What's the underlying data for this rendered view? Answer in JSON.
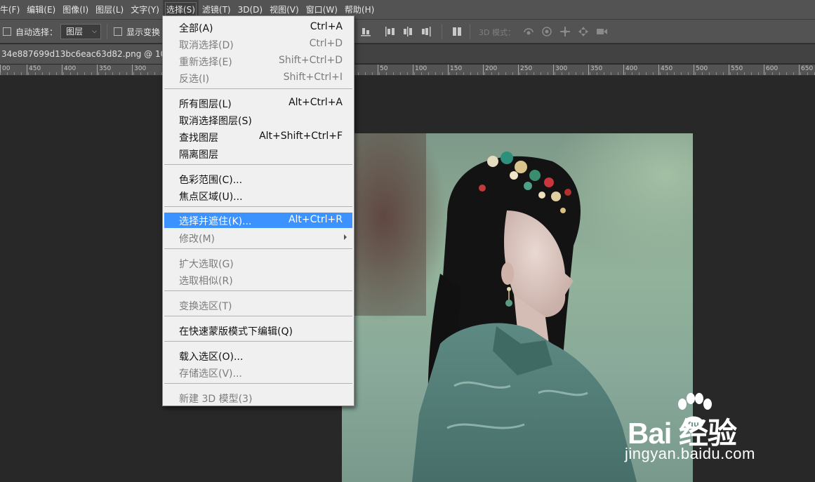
{
  "menubar": {
    "items": [
      "牛(F)",
      "编辑(E)",
      "图像(I)",
      "图层(L)",
      "文字(Y)",
      "选择(S)",
      "滤镜(T)",
      "3D(D)",
      "视图(V)",
      "窗口(W)",
      "帮助(H)"
    ],
    "active": "选择(S)"
  },
  "options": {
    "auto_select_label": "自动选择：",
    "layer_dropdown": "图层",
    "show_transform_label": "显示变换",
    "mode_3d_label": "3D 模式："
  },
  "document": {
    "tab_title": "34e887699d13bc6eac63d82.png @ 100%(..."
  },
  "ruler": {
    "labels": [
      "00",
      "450",
      "400",
      "350",
      "300",
      "50",
      "100",
      "150",
      "200",
      "250",
      "300",
      "350",
      "400",
      "450",
      "500",
      "550",
      "600",
      "650"
    ]
  },
  "select_menu": {
    "items": [
      {
        "label": "全部(A)",
        "shortcut": "Ctrl+A",
        "enabled": true
      },
      {
        "label": "取消选择(D)",
        "shortcut": "Ctrl+D",
        "enabled": false
      },
      {
        "label": "重新选择(E)",
        "shortcut": "Shift+Ctrl+D",
        "enabled": false
      },
      {
        "label": "反选(I)",
        "shortcut": "Shift+Ctrl+I",
        "enabled": false
      },
      {
        "label": "所有图层(L)",
        "shortcut": "Alt+Ctrl+A",
        "enabled": true
      },
      {
        "label": "取消选择图层(S)",
        "shortcut": "",
        "enabled": true
      },
      {
        "label": "查找图层",
        "shortcut": "Alt+Shift+Ctrl+F",
        "enabled": true
      },
      {
        "label": "隔离图层",
        "shortcut": "",
        "enabled": true
      },
      {
        "label": "色彩范围(C)...",
        "shortcut": "",
        "enabled": true
      },
      {
        "label": "焦点区域(U)...",
        "shortcut": "",
        "enabled": true
      },
      {
        "label": "选择并遮住(K)...",
        "shortcut": "Alt+Ctrl+R",
        "enabled": true,
        "highlighted": true
      },
      {
        "label": "修改(M)",
        "shortcut": "",
        "enabled": false,
        "submenu": true
      },
      {
        "label": "扩大选取(G)",
        "shortcut": "",
        "enabled": false
      },
      {
        "label": "选取相似(R)",
        "shortcut": "",
        "enabled": false
      },
      {
        "label": "变换选区(T)",
        "shortcut": "",
        "enabled": false
      },
      {
        "label": "在快速蒙版模式下编辑(Q)",
        "shortcut": "",
        "enabled": true
      },
      {
        "label": "载入选区(O)...",
        "shortcut": "",
        "enabled": true
      },
      {
        "label": "存储选区(V)...",
        "shortcut": "",
        "enabled": false
      },
      {
        "label": "新建 3D 模型(3)",
        "shortcut": "",
        "enabled": false
      }
    ]
  },
  "watermark": {
    "brand": "Bai 经验",
    "url": "jingyan.baidu.com"
  },
  "colors": {
    "highlight": "#3c92ff",
    "menubar_bg": "#535353",
    "canvas_bg": "#282828"
  }
}
